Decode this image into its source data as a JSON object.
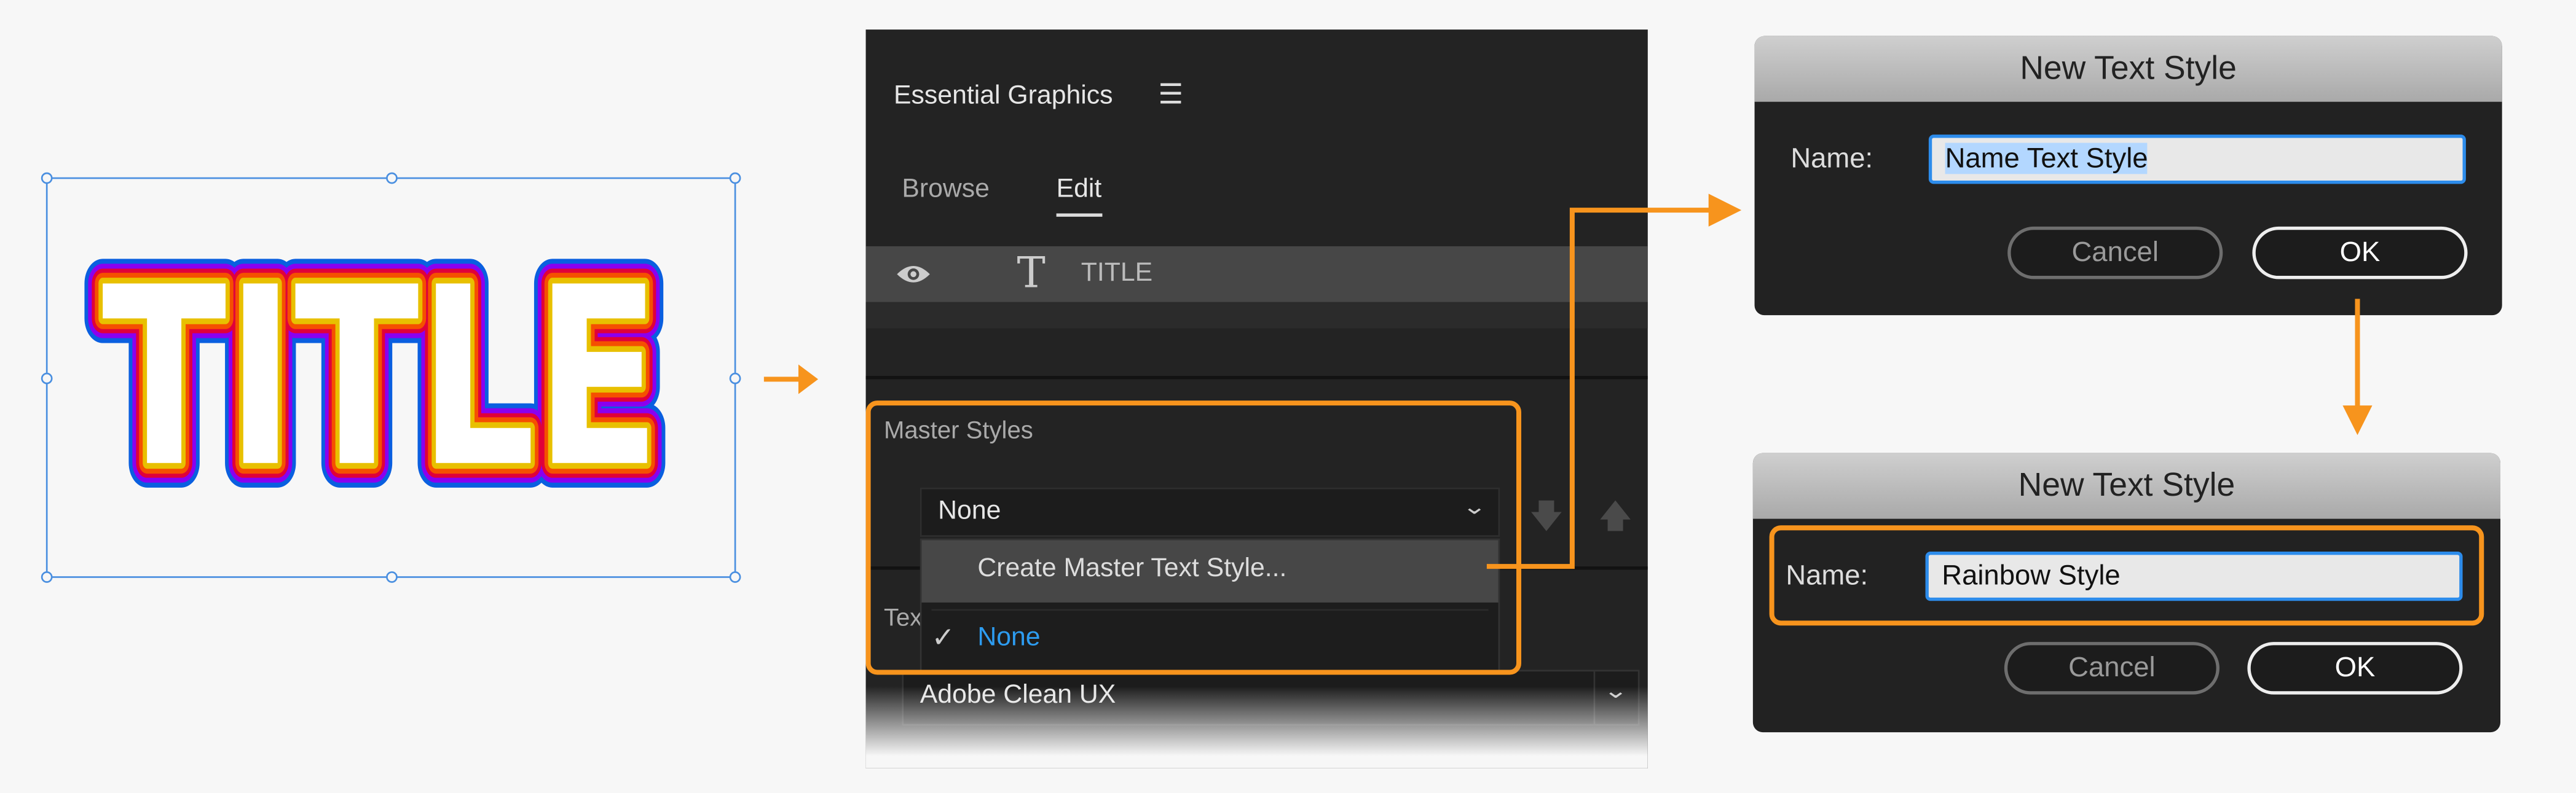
{
  "canvas": {
    "title_text": "TITLE",
    "rainbow_colors": [
      "#0a5fe0",
      "#8a00f0",
      "#e0003a",
      "#f55000",
      "#e8c000",
      "#ffffff"
    ]
  },
  "panel": {
    "title": "Essential Graphics",
    "menu_icon": "hamburger-icon",
    "tabs": [
      {
        "label": "Browse",
        "active": false
      },
      {
        "label": "Edit",
        "active": true
      }
    ],
    "layer": {
      "name": "TITLE",
      "visibility_icon": "eye-icon",
      "type_icon": "text-tool-icon"
    },
    "master_styles": {
      "label": "Master Styles",
      "selected": "None",
      "menu_items": [
        {
          "label": "Create Master Text Style...",
          "highlighted": true
        },
        {
          "label": "None",
          "checked": true
        }
      ],
      "push_icon": "arrow-down-icon",
      "pull_icon": "arrow-up-icon"
    },
    "text_section_label": "Tex",
    "font": "Adobe Clean UX"
  },
  "dialog1": {
    "title": "New Text Style",
    "name_label": "Name:",
    "name_value": "Name Text Style",
    "cancel": "Cancel",
    "ok": "OK"
  },
  "dialog2": {
    "title": "New Text Style",
    "name_label": "Name:",
    "name_value": "Rainbow Style",
    "cancel": "Cancel",
    "ok": "OK"
  },
  "colors": {
    "accent": "#f7941d",
    "selection_blue": "#4a8fe0",
    "checked_item": "#2d9cf0"
  }
}
